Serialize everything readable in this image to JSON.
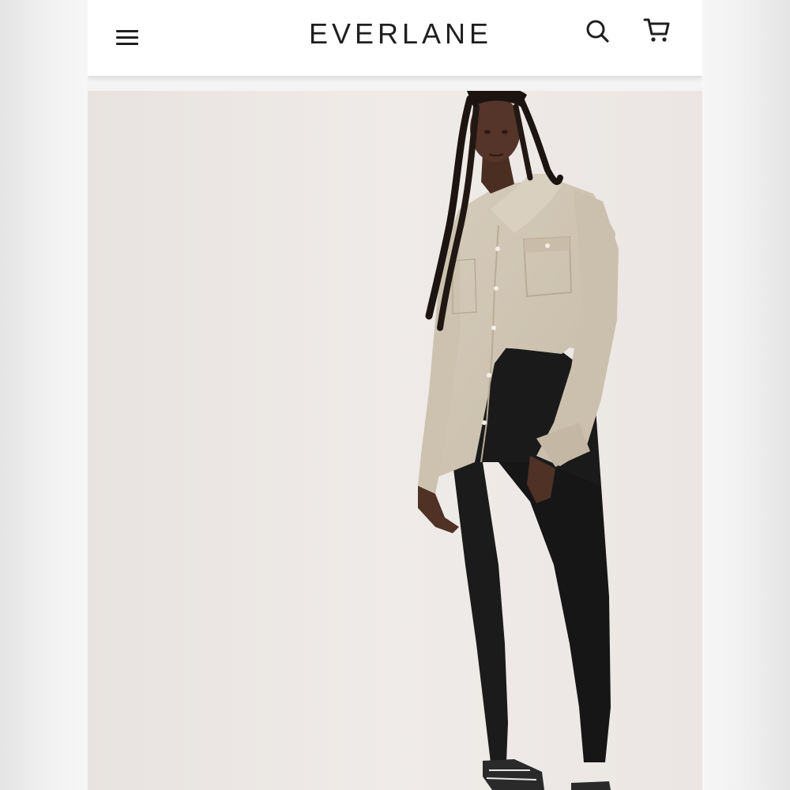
{
  "header": {
    "brand": "EVERLANE",
    "icons": {
      "menu": "hamburger-menu-icon",
      "search": "search-icon",
      "cart": "cart-icon"
    }
  },
  "colors": {
    "header_bg": "#ffffff",
    "brand_text": "#1f1f1f",
    "hero_bg": "#ece7e4",
    "shirt": "#cfc4b2",
    "jeans": "#1a1a1a"
  }
}
